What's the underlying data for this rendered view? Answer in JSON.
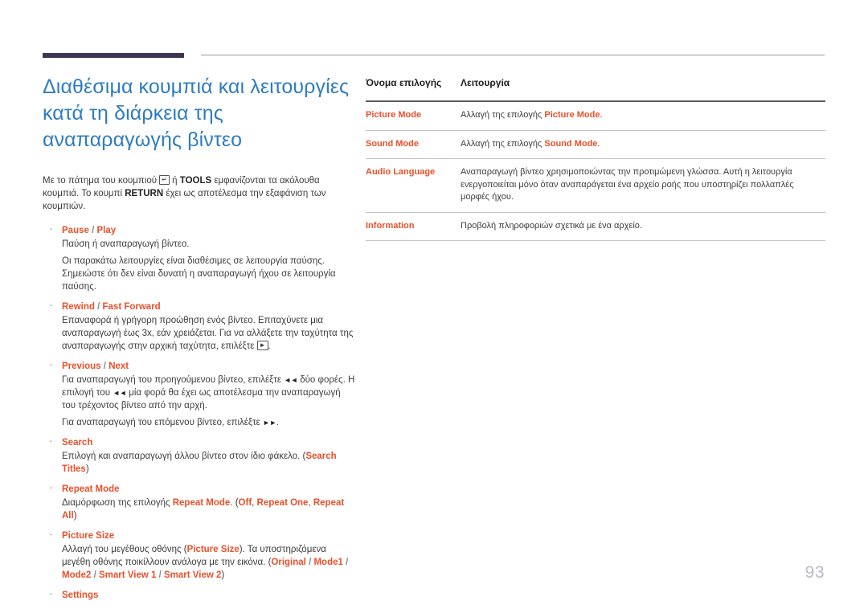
{
  "header": {
    "rule_bar_color": "#3f3552",
    "rule_line_color": "#9a9a9a"
  },
  "colors": {
    "title_blue": "#2f7dc0",
    "accent_orange": "#e8502a",
    "body_gray": "#3d3d3d",
    "page_number_gray": "#b9b9c4"
  },
  "title": "Διαθέσιμα κουμπιά και λειτουργίες κατά τη διάρκεια της αναπαραγωγής βίντεο",
  "intro": {
    "part1": "Με το πάτημα του κουμπιού ",
    "enter_key_icon": "↵",
    "part2": " ή ",
    "tools_label": "TOOLS",
    "part3": " εμφανίζονται τα ακόλουθα κουμπιά. Το κουμπί ",
    "return_label": "RETURN",
    "part4": " έχει ως αποτέλεσμα την εξαφάνιση των κουμπιών."
  },
  "bullets": [
    {
      "head_a": "Pause",
      "head_sep": "/",
      "head_b": "Play",
      "paras": [
        "Παύση ή αναπαραγωγή βίντεο.",
        "Οι παρακάτω λειτουργίες είναι διαθέσιμες σε λειτουργία παύσης. Σημειώστε ότι δεν είναι δυνατή η αναπαραγωγή ήχου σε λειτουργία παύσης."
      ]
    },
    {
      "head_a": "Rewind",
      "head_sep": "/",
      "head_b": "Fast Forward",
      "body_pre": "Επαναφορά ή γρήγορη προώθηση ενός βίντεο. Επιταχύνετε μια αναπαραγωγή έως 3x, εάν χρειάζεται. Για να αλλάξετε την ταχύτητα της αναπαραγωγής στην αρχική ταχύτητα, επιλέξτε ",
      "play_key_icon": "►",
      "body_post": "."
    },
    {
      "head_a": "Previous",
      "head_sep": "/",
      "head_b": "Next",
      "line1_pre": "Για αναπαραγωγή του προηγούμενου βίντεο, επιλέξτε ",
      "prev_icon": "◄◄",
      "line1_mid": " δύο φορές. Η επιλογή του ",
      "prev_icon2": "◄◄",
      "line1_post": " μία φορά θα έχει ως αποτέλεσμα την αναπαραγωγή του τρέχοντος βίντεο από την αρχή.",
      "line2_pre": "Για αναπαραγωγή του επόμενου βίντεο, επιλέξτε ",
      "next_icon": "►►",
      "line2_post": "."
    },
    {
      "head_a": "Search",
      "body_pre": "Επιλογή και αναπαραγωγή άλλου βίντεο στον ίδιο φάκελο. (",
      "body_em": "Search Titles",
      "body_post": ")"
    },
    {
      "head_a": "Repeat Mode",
      "body_pre": "Διαμόρφωση της επιλογής ",
      "body_em1": "Repeat Mode",
      "body_mid1": ". (",
      "body_em2": "Off",
      "body_mid2": ", ",
      "body_em3": "Repeat One",
      "body_mid3": ", ",
      "body_em4": "Repeat All",
      "body_post": ")"
    },
    {
      "head_a": "Picture Size",
      "body_pre": "Αλλαγή του μεγέθους οθόνης (",
      "body_em1": "Picture Size",
      "body_mid1": "). Τα υποστηριζόμενα μεγέθη οθόνης ποικίλλουν ανάλογα με την εικόνα. (",
      "body_em2": "Original",
      "body_sep1": " / ",
      "body_em3": "Mode1",
      "body_sep2": " / ",
      "body_em4": "Mode2",
      "body_sep3": " / ",
      "body_em5": "Smart View 1",
      "body_sep4": " / ",
      "body_em6": "Smart View 2",
      "body_post": ")"
    },
    {
      "head_a": "Settings"
    }
  ],
  "table": {
    "headers": {
      "col1": "Όνομα επιλογής",
      "col2": "Λειτουργία"
    },
    "rows": [
      {
        "name": "Picture Mode",
        "desc_pre": "Αλλαγή της επιλογής ",
        "desc_em": "Picture Mode",
        "desc_post": "."
      },
      {
        "name": "Sound Mode",
        "desc_pre": "Αλλαγή της επιλογής ",
        "desc_em": "Sound Mode",
        "desc_post": "."
      },
      {
        "name": "Audio Language",
        "desc_plain": "Αναπαραγωγή βίντεο χρησιμοποιώντας την προτιμώμενη γλώσσα. Αυτή η λειτουργία ενεργοποιείται μόνο όταν αναπαράγεται ένα αρχείο ροής που υποστηρίζει πολλαπλές μορφές ήχου."
      },
      {
        "name": "Information",
        "desc_plain": "Προβολή πληροφοριών σχετικά με ένα αρχείο."
      }
    ]
  },
  "page_number": "93"
}
